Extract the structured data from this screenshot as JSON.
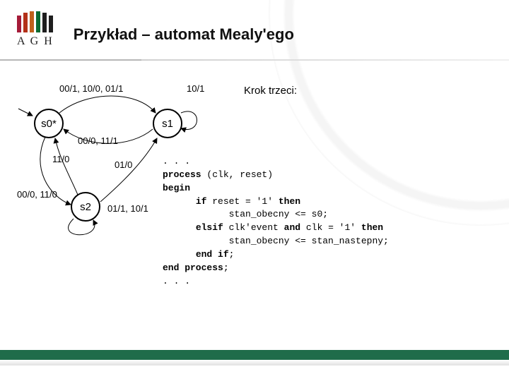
{
  "logo": {
    "text": "A G H"
  },
  "title": "Przykład – automat Mealy'ego",
  "subtitle": "Krok trzeci:",
  "diagram": {
    "states": {
      "s0": "s0*",
      "s1": "s1",
      "s2": "s2"
    },
    "transitions": {
      "s0_s1_top": "00/1, 10/0, 01/1",
      "s1_self": "10/1",
      "s1_s0_mid": "00/0, 11/1",
      "s0_s2_left": "11/0",
      "s2_s1": "01/0",
      "s2_self": "00/0, 11/0",
      "s2_s0_right": "01/1, 10/1"
    }
  },
  "code": {
    "ellipsis1": ". . .",
    "kw_process": "process",
    "proc_args": " (clk, reset)",
    "kw_begin": "begin",
    "kw_if": "if",
    "cond_reset": " reset = '1' ",
    "kw_then": "then",
    "assign_reset": "stan_obecny <= s0;",
    "kw_elsif": "elsif",
    "cond_clk_pre": " clk'event ",
    "kw_and": "and",
    "cond_clk_post": " clk = '1' ",
    "assign_next": "stan_obecny <= stan_nastepny;",
    "kw_endif": "end if",
    "endif_semi": ";",
    "kw_endprocess": "end process",
    "endproc_semi": ";",
    "ellipsis2": ". . ."
  }
}
